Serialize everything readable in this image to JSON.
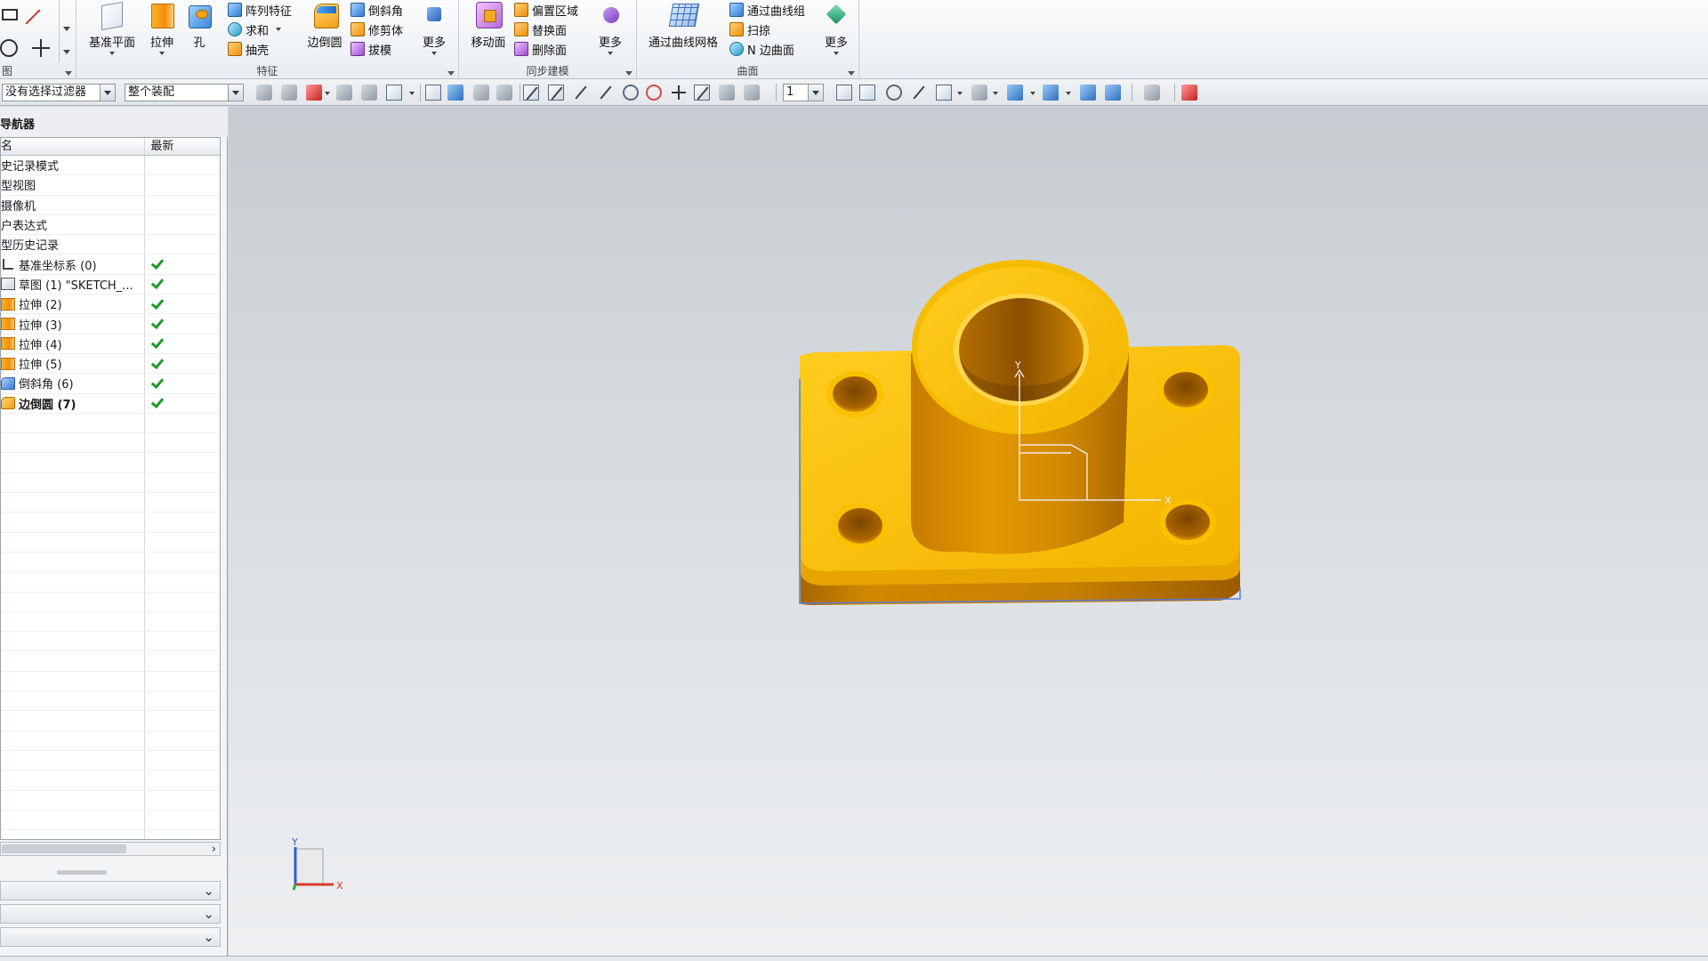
{
  "ribbon": {
    "left_group_label": "图",
    "features": {
      "datum_plane": "基准平面",
      "extrude": "拉伸",
      "hole": "孔",
      "pattern_feature": "阵列特征",
      "unite": "求和",
      "shell": "抽壳",
      "edge_blend": "边倒圆",
      "chamfer": "倒斜角",
      "trim_body": "修剪体",
      "draft": "拔模",
      "more": "更多",
      "group_label": "特征"
    },
    "sync": {
      "move_face": "移动面",
      "offset_region": "偏置区域",
      "replace_face": "替换面",
      "delete_face": "删除面",
      "more": "更多",
      "group_label": "同步建模"
    },
    "surface": {
      "through_curve_mesh": "通过曲线网格",
      "through_curves": "通过曲线组",
      "swept": "扫掠",
      "n_sided": "N 边曲面",
      "more": "更多",
      "group_label": "曲面"
    }
  },
  "toolbar2": {
    "selection_filter": "没有选择过滤器",
    "assembly_scope": "整个装配",
    "layer_value": "1"
  },
  "navigator": {
    "title": "导航器",
    "col_name": "名",
    "col_latest": "最新",
    "rows": [
      {
        "label": "史记录模式",
        "icon": "none",
        "check": false,
        "bold": false
      },
      {
        "label": "型视图",
        "icon": "none",
        "check": false,
        "bold": false
      },
      {
        "label": "摄像机",
        "icon": "none",
        "check": false,
        "bold": false
      },
      {
        "label": "户表达式",
        "icon": "none",
        "check": false,
        "bold": false
      },
      {
        "label": "型历史记录",
        "icon": "none",
        "check": false,
        "bold": false
      },
      {
        "label": "基准坐标系 (0)",
        "icon": "coord",
        "check": true,
        "bold": false
      },
      {
        "label": "草图 (1) \"SKETCH_...",
        "icon": "sketch",
        "check": true,
        "bold": false
      },
      {
        "label": "拉伸 (2)",
        "icon": "extrude",
        "check": true,
        "bold": false
      },
      {
        "label": "拉伸 (3)",
        "icon": "extrude",
        "check": true,
        "bold": false
      },
      {
        "label": "拉伸 (4)",
        "icon": "extrude",
        "check": true,
        "bold": false
      },
      {
        "label": "拉伸 (5)",
        "icon": "extrude",
        "check": true,
        "bold": false
      },
      {
        "label": "倒斜角 (6)",
        "icon": "chamfer",
        "check": true,
        "bold": false
      },
      {
        "label": "边倒圆 (7)",
        "icon": "blend",
        "check": true,
        "bold": true
      }
    ]
  },
  "viewport": {
    "triad_x": "X",
    "triad_y": "Y",
    "sketch_x": "X",
    "sketch_y": "Y",
    "part_color": "#f6b700",
    "part_dark": "#c47a00"
  }
}
